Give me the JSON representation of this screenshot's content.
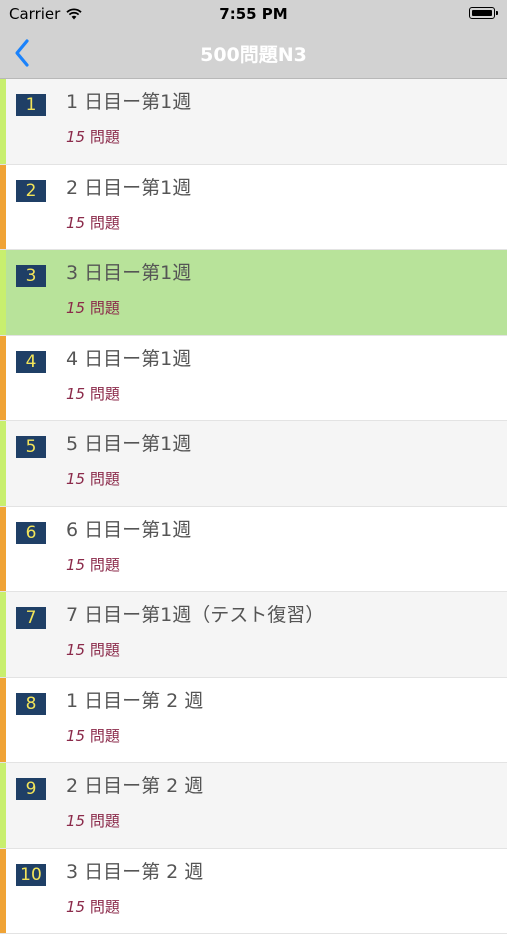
{
  "status_bar": {
    "carrier": "Carrier",
    "time": "7:55 PM"
  },
  "nav": {
    "title": "500問題N3"
  },
  "colors": {
    "stripe_green": "#c8ef6e",
    "stripe_orange": "#f0a335",
    "row_selected": "#b8e39a",
    "row_alt": "#f5f5f5",
    "badge_bg": "#1f3f66",
    "badge_text": "#f2e45a",
    "count_text": "#8b2a4a"
  },
  "rows": [
    {
      "num": "1",
      "title": "1 日目ー第1週",
      "count": "15",
      "unit": "問題"
    },
    {
      "num": "2",
      "title": "2 日目ー第1週",
      "count": "15",
      "unit": "問題"
    },
    {
      "num": "3",
      "title": "3 日目ー第1週",
      "count": "15",
      "unit": "問題"
    },
    {
      "num": "4",
      "title": "4 日目ー第1週",
      "count": "15",
      "unit": "問題"
    },
    {
      "num": "5",
      "title": "5 日目ー第1週",
      "count": "15",
      "unit": "問題"
    },
    {
      "num": "6",
      "title": "6 日目ー第1週",
      "count": "15",
      "unit": "問題"
    },
    {
      "num": "7",
      "title": "7 日目ー第1週（テスト復習）",
      "count": "15",
      "unit": "問題"
    },
    {
      "num": "8",
      "title": "1 日目ー第 2 週",
      "count": "15",
      "unit": "問題"
    },
    {
      "num": "9",
      "title": "2 日目ー第 2 週",
      "count": "15",
      "unit": "問題"
    },
    {
      "num": "10",
      "title": "3 日目ー第 2 週",
      "count": "15",
      "unit": "問題"
    }
  ]
}
